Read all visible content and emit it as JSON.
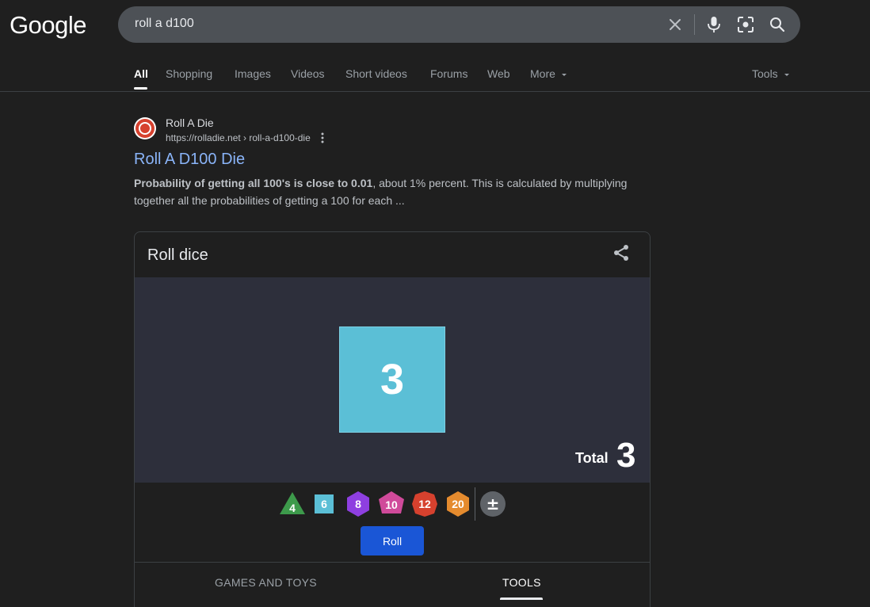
{
  "header": {
    "logo_text": "Google",
    "search": {
      "value": "roll a d100",
      "clear_icon": "close-icon",
      "voice_icon": "microphone-icon",
      "lens_icon": "camera-lens-icon",
      "search_icon": "search-icon"
    }
  },
  "tabs": {
    "items": [
      {
        "label": "All",
        "active": true
      },
      {
        "label": "Shopping"
      },
      {
        "label": "Images"
      },
      {
        "label": "Videos"
      },
      {
        "label": "Short videos"
      },
      {
        "label": "Forums"
      },
      {
        "label": "Web"
      },
      {
        "label": "More"
      }
    ],
    "tools_label": "Tools"
  },
  "result": {
    "site_name": "Roll A Die",
    "url": "https://rolladie.net › roll-a-d100-die",
    "title": "Roll A D100 Die",
    "snippet_bold": "Probability of getting all 100's is close to 0.01",
    "snippet_rest": ", about 1% percent. This is calculated by multiplying together all the probabilities of getting a 100 for each ..."
  },
  "dice_card": {
    "title": "Roll dice",
    "die_value": "3",
    "total_label": "Total",
    "total_value": "3",
    "dice": [
      {
        "label": "4",
        "shape": "triangle",
        "color": "#3d9a4b"
      },
      {
        "label": "6",
        "shape": "square",
        "color": "#5bbfd6"
      },
      {
        "label": "8",
        "shape": "hexagon",
        "color": "#8e3fe0"
      },
      {
        "label": "10",
        "shape": "diamond",
        "color": "#d04a9a"
      },
      {
        "label": "12",
        "shape": "hexagon",
        "color": "#d6412e"
      },
      {
        "label": "20",
        "shape": "hexagon",
        "color": "#e58b2e"
      }
    ],
    "modifier_label": "±",
    "roll_label": "Roll",
    "categories": [
      {
        "label": "GAMES AND TOYS"
      },
      {
        "label": "TOOLS",
        "active": true
      }
    ],
    "colors": {
      "stage_bg": "#2d2f3b",
      "die_face": "#5bbfd6",
      "roll_button": "#1a56d6"
    }
  }
}
